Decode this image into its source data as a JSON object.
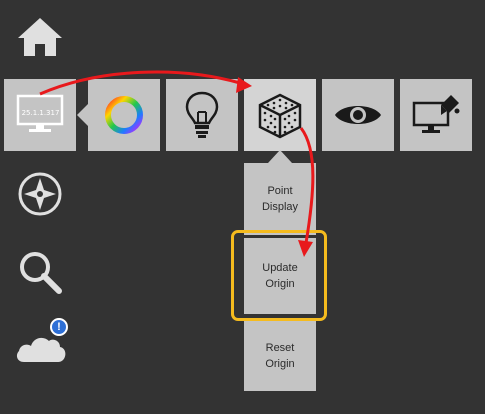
{
  "sidebar": {
    "home_icon": "home-icon",
    "compass_icon": "compass-icon",
    "search_icon": "search-icon",
    "cloud_icon": "cloud-icon",
    "notification_badge": "!"
  },
  "toolbar": {
    "monitor_label": "25.1.1.317",
    "tiles": [
      {
        "icon": "monitor-icon"
      },
      {
        "icon": "color-wheel-icon"
      },
      {
        "icon": "lightbulb-icon"
      },
      {
        "icon": "point-cloud-cube-icon"
      },
      {
        "icon": "eye-icon"
      },
      {
        "icon": "monitor-paint-icon"
      }
    ]
  },
  "dropdown": {
    "items": [
      {
        "line1": "Point",
        "line2": "Display"
      },
      {
        "line1": "Update",
        "line2": "Origin"
      },
      {
        "line1": "Reset",
        "line2": "Origin"
      }
    ]
  },
  "annotations": {
    "arrow_color": "#e8191c",
    "highlight_color": "#f5bb1e"
  }
}
